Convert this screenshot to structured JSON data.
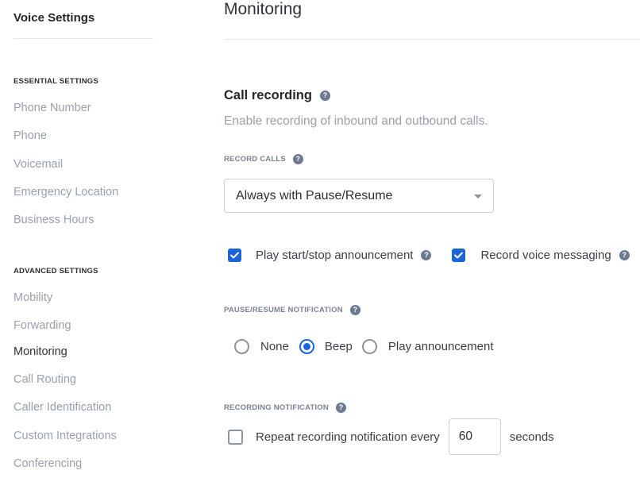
{
  "sidebar": {
    "title": "Voice Settings",
    "sections": [
      {
        "heading": "ESSENTIAL SETTINGS",
        "items": [
          "Phone Number",
          "Phone",
          "Voicemail",
          "Emergency Location",
          "Business Hours"
        ]
      },
      {
        "heading": "ADVANCED SETTINGS",
        "items": [
          "Mobility",
          "Forwarding",
          "Monitoring",
          "Call Routing",
          "Caller Identification",
          "Custom Integrations",
          "Conferencing"
        ]
      }
    ],
    "active_item": "Monitoring"
  },
  "main": {
    "page_title": "Monitoring",
    "call_recording": {
      "title": "Call recording",
      "description": "Enable recording of inbound and outbound calls.",
      "record_calls": {
        "label": "RECORD CALLS",
        "selected": "Always with Pause/Resume"
      },
      "options": [
        {
          "label": "Play start/stop announcement",
          "checked": true
        },
        {
          "label": "Record voice messaging",
          "checked": true
        }
      ],
      "pause_resume_notification": {
        "label": "PAUSE/RESUME NOTIFICATION",
        "choices": [
          "None",
          "Beep",
          "Play announcement"
        ],
        "selected": "Beep"
      },
      "recording_notification": {
        "label": "RECORDING NOTIFICATION",
        "repeat_label": "Repeat recording notification every",
        "repeat_checked": false,
        "interval_value": "60",
        "unit_label": "seconds"
      }
    }
  },
  "icons": {
    "help": "?",
    "check": "checkmark-icon",
    "caret": "chevron-down-icon"
  },
  "colors": {
    "accent": "#1a63d9",
    "help_icon": "#6b7a90",
    "muted_text": "#9aa1ac"
  }
}
